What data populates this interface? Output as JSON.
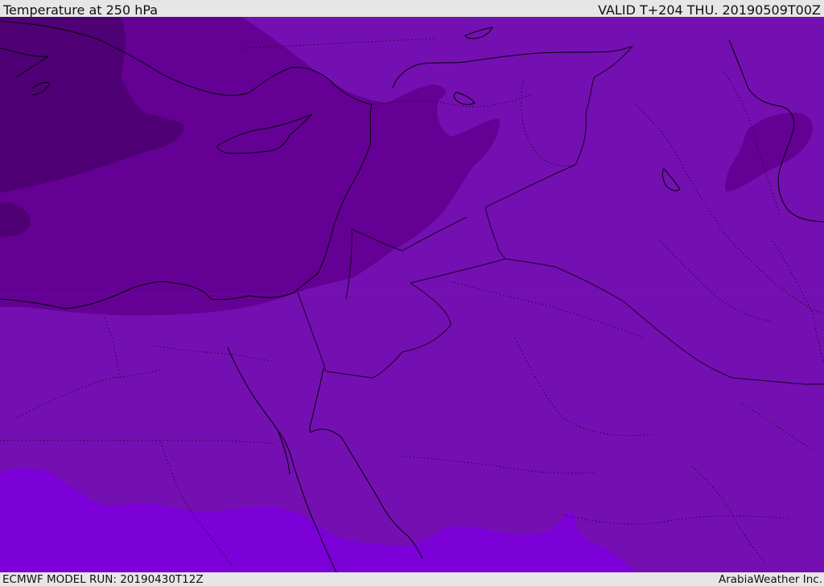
{
  "header": {
    "title": "Temperature at 250 hPa",
    "valid": "VALID T+204 THU. 20190509T00Z"
  },
  "footer": {
    "model_run": "ECMWF MODEL RUN: 20190430T12Z",
    "credit": "ArabiaWeather Inc."
  },
  "map": {
    "field": "temperature",
    "level": "250 hPa",
    "colors": {
      "coldest": "#4f0075",
      "colder": "#650094",
      "base": "#7410b2",
      "warm": "#7c00d8",
      "coast": "#000000"
    }
  }
}
